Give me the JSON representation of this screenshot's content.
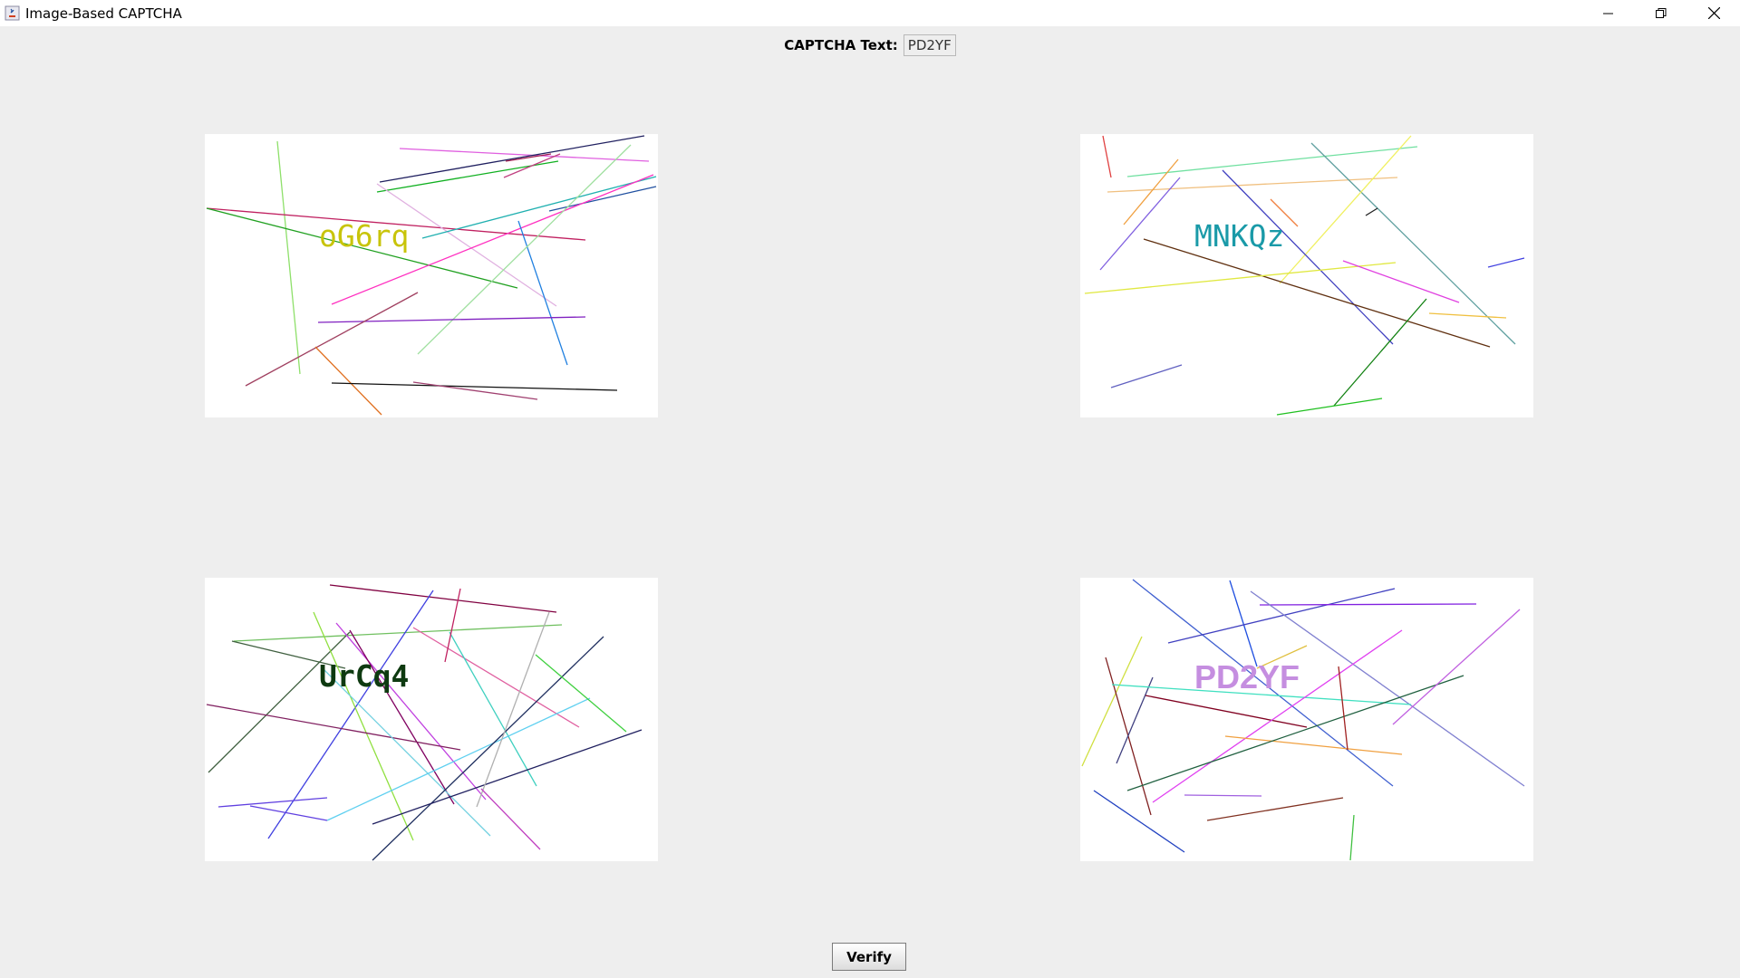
{
  "window": {
    "title": "Image-Based CAPTCHA",
    "controls": [
      "minimize",
      "restore",
      "close"
    ]
  },
  "captcha": {
    "label": "CAPTCHA Text:",
    "value": "PD2YF"
  },
  "images": [
    {
      "text": "oG6rq",
      "color": "#c8c40a"
    },
    {
      "text": "MNKQz",
      "color": "#1a9aa8"
    },
    {
      "text": "UrCq4",
      "color": "#0e3a10"
    },
    {
      "text": "PD2YF",
      "color": "#c58ee0"
    }
  ],
  "verify": {
    "label": "Verify"
  }
}
